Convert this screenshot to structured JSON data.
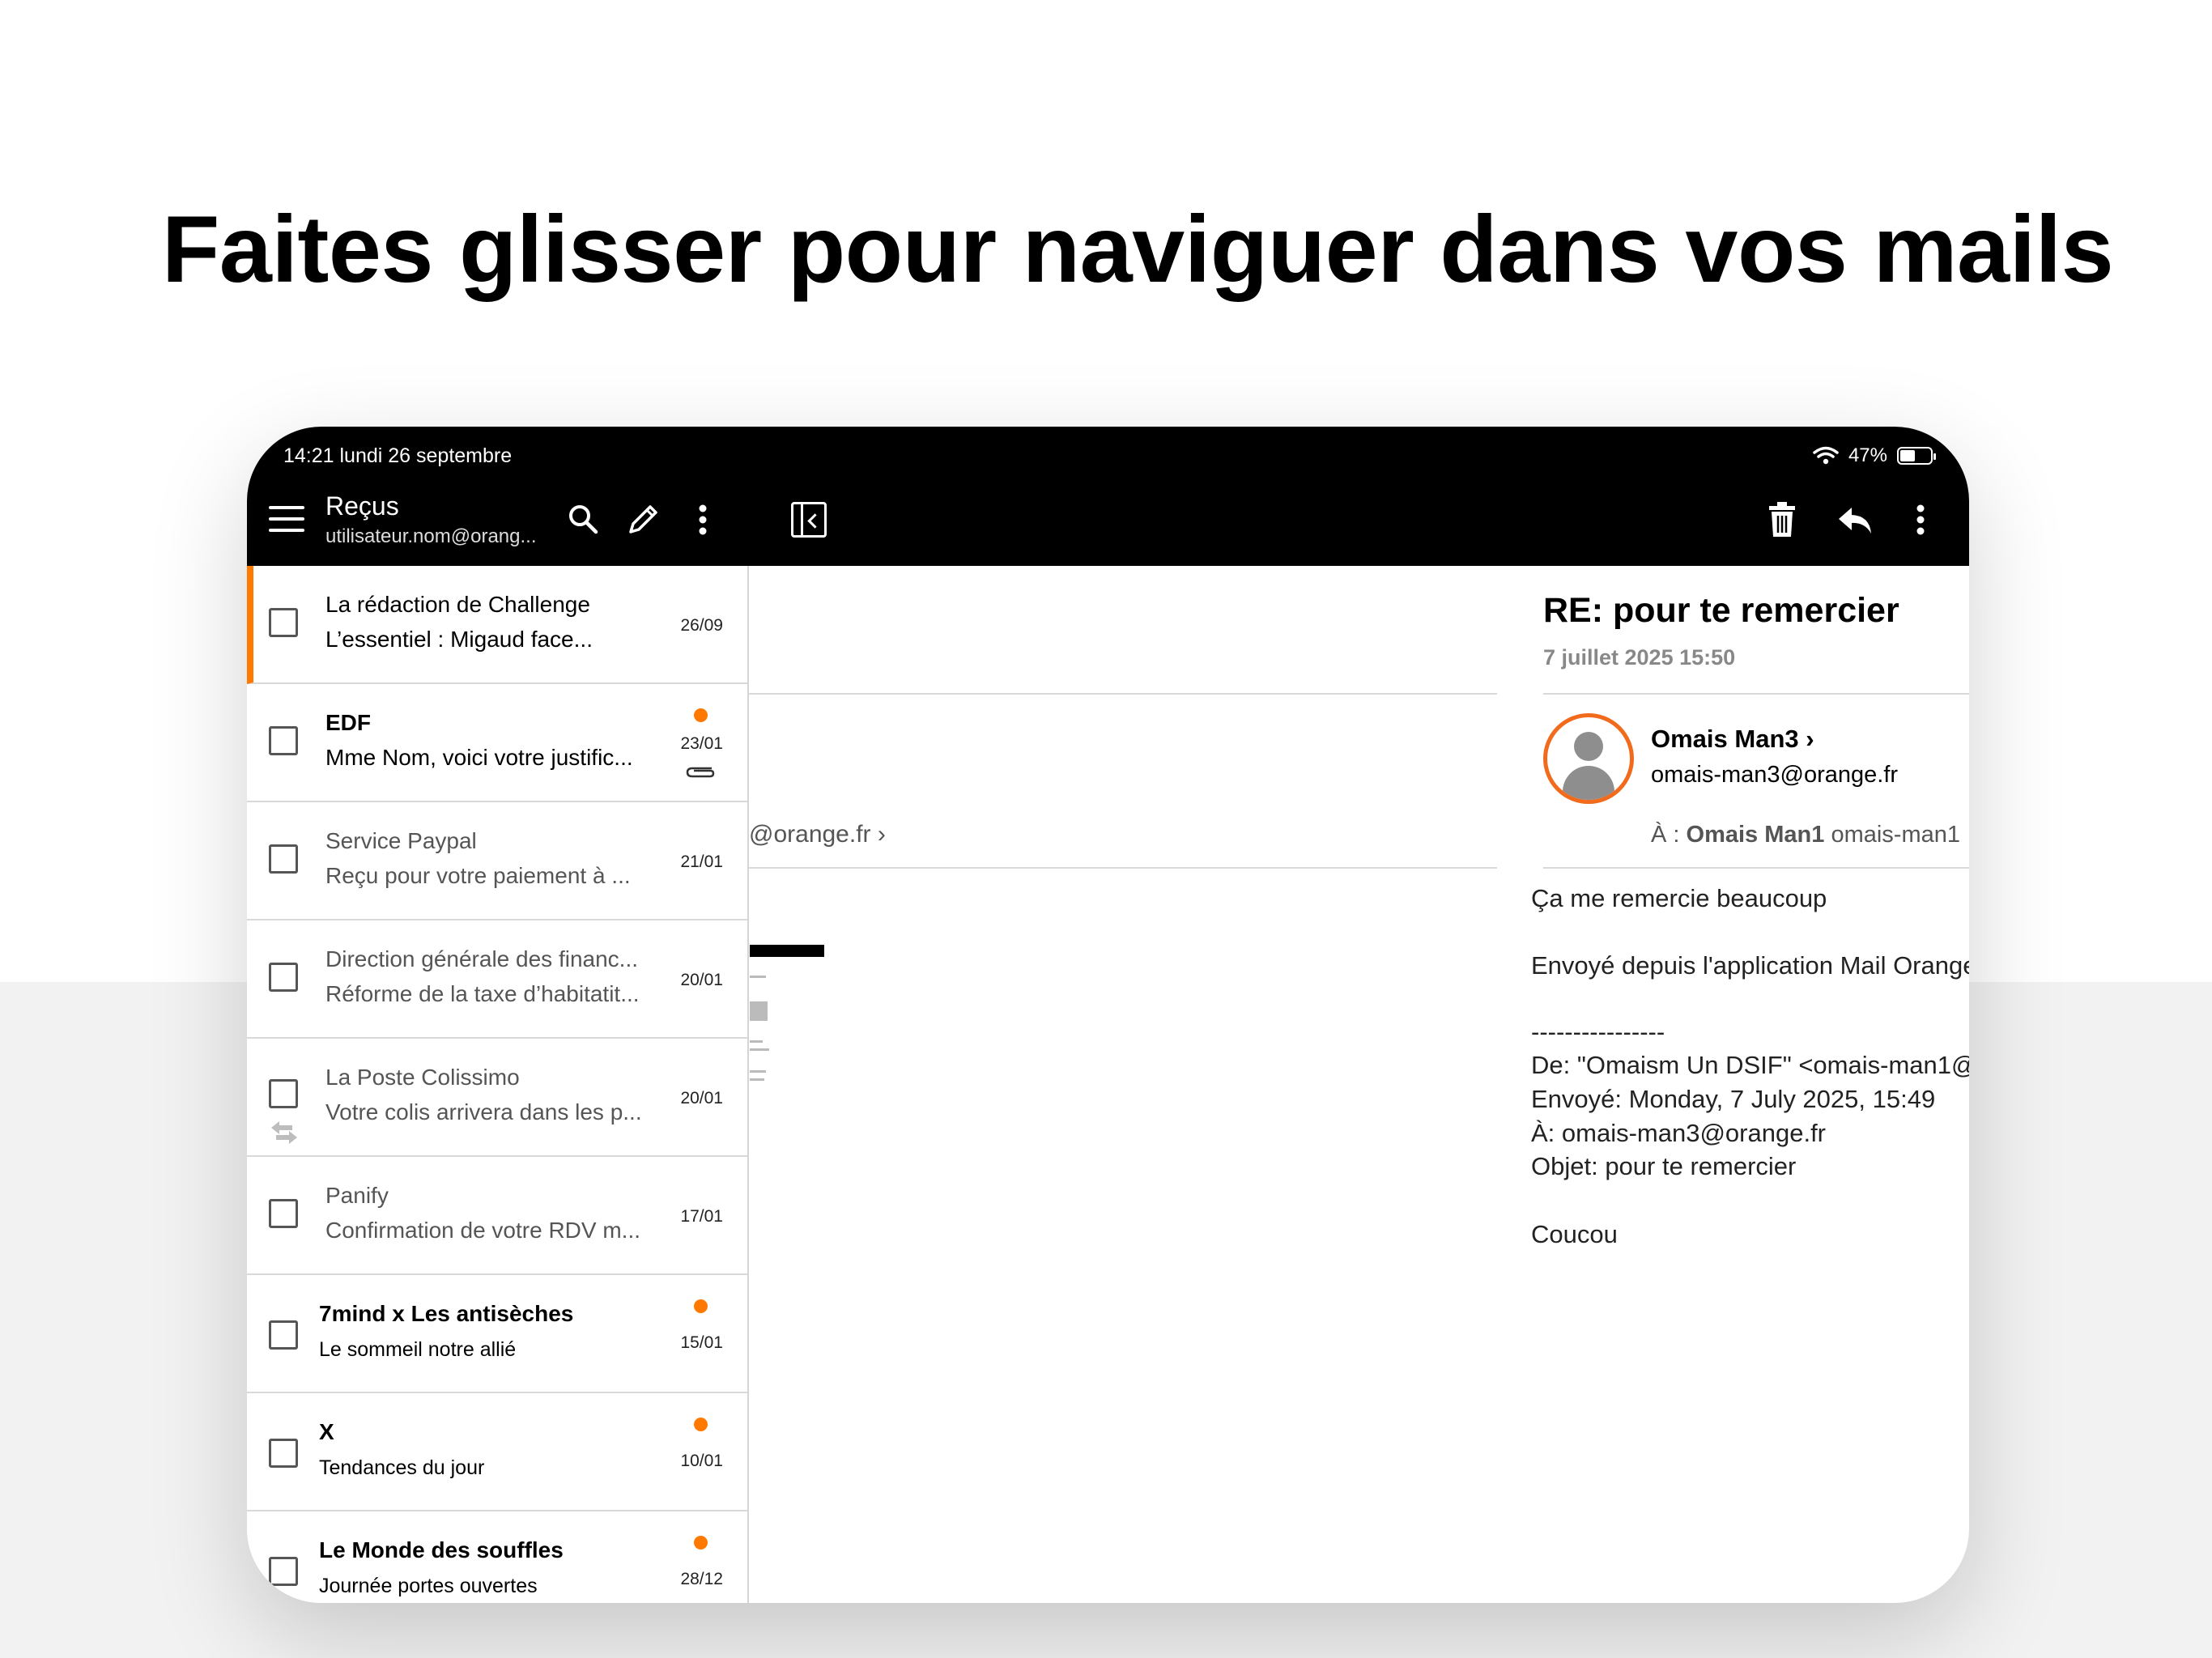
{
  "headline": "Faites glisser pour naviguer dans vos mails",
  "status": {
    "time": "14:21 lundi 26 septembre",
    "battery": "47%"
  },
  "header": {
    "folder": "Reçus",
    "account": "utilisateur.nom@orang..."
  },
  "icons": {
    "menu": "hamburger-icon",
    "search": "search-icon",
    "compose": "pencil-icon",
    "more": "kebab-icon",
    "collapse": "sidebar-collapse-icon",
    "delete": "trash-icon",
    "reply": "reply-icon"
  },
  "colors": {
    "accent": "#ff7900",
    "avatar_ring": "#f26a1b",
    "header_bg": "#000000"
  },
  "mails": [
    {
      "sender": "La rédaction de Challenge",
      "subject": "L’essentiel : Migaud face...",
      "date": "26/09",
      "state": "selected"
    },
    {
      "sender": "EDF",
      "subject": "Mme Nom, voici votre justific...",
      "date": "23/01",
      "state": "unread",
      "attachment": true
    },
    {
      "sender": "Service Paypal",
      "subject": "Reçu pour votre paiement à ...",
      "date": "21/01",
      "state": "read"
    },
    {
      "sender": "Direction générale des financ...",
      "subject": "Réforme de la taxe d’habitatit...",
      "date": "20/01",
      "state": "read"
    },
    {
      "sender": "La Poste Colissimo",
      "subject": "Votre colis arrivera dans les p...",
      "date": "20/01",
      "state": "read",
      "forwarded": true
    },
    {
      "sender": "Panify",
      "subject": "Confirmation de votre RDV m...",
      "date": "17/01",
      "state": "read"
    },
    {
      "sender": "7mind x Les antisèches",
      "subject": "Le sommeil notre allié",
      "date": "15/01",
      "state": "unread"
    },
    {
      "sender": "X",
      "subject": "Tendances du jour",
      "date": "10/01",
      "state": "unread"
    },
    {
      "sender": "Le Monde des souffles",
      "subject": "Journée portes ouvertes",
      "date": "28/12",
      "state": "unread"
    }
  ],
  "previous_mail": {
    "email_fragment": "@orange.fr"
  },
  "message": {
    "subject": "RE: pour te remercier",
    "date": "7 juillet 2025 15:50",
    "from_name": "Omais Man3",
    "from_email": "omais-man3@orange.fr",
    "to_prefix": "À :",
    "to_name": "Omais Man1",
    "to_email": "omais-man1",
    "body": [
      "Ça me remercie beaucoup",
      "Envoyé depuis l'application Mail Orange",
      "----------------",
      "De: \"Omaism Un DSIF\" <omais-man1@",
      "Envoyé: Monday, 7 July 2025, 15:49",
      "À: omais-man3@orange.fr",
      "Objet: pour te remercier",
      "Coucou"
    ]
  }
}
